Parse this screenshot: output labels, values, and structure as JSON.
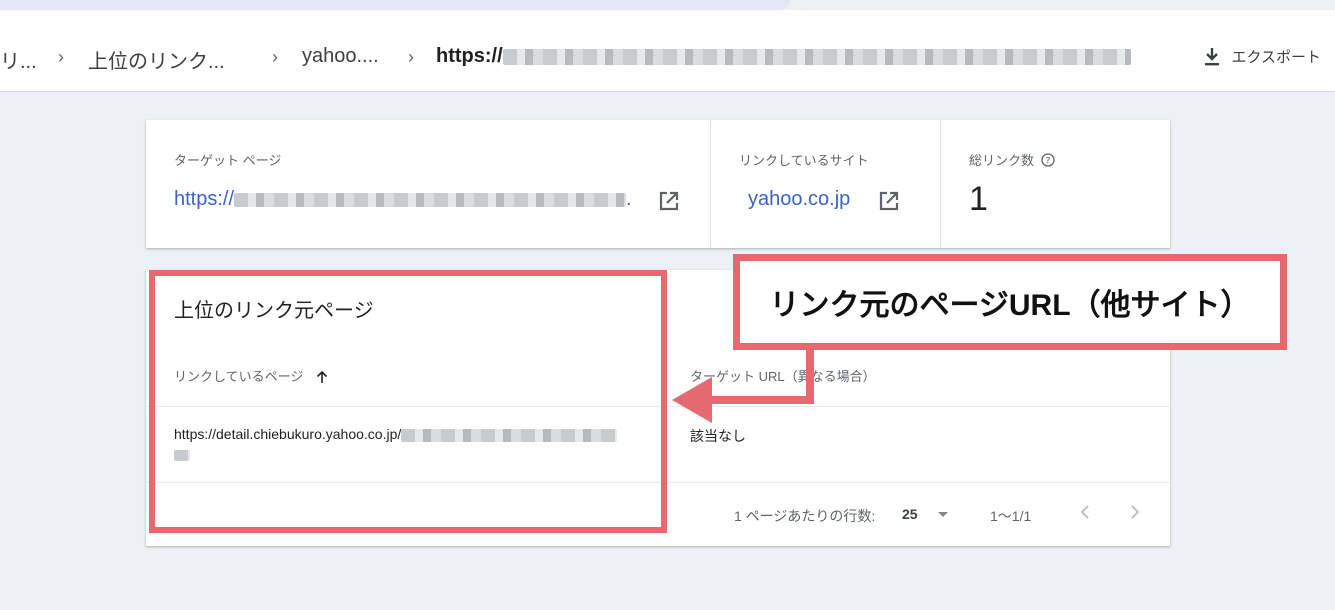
{
  "breadcrumb": {
    "item1": "リ...",
    "item2": "上位のリンク...",
    "item3": "yahoo....",
    "item4": "https://"
  },
  "header": {
    "export_label": "エクスポート",
    "export_icon": "download-icon"
  },
  "summary": {
    "target_label": "ターゲット ページ",
    "target_url_prefix": "https://",
    "target_url_suffix": ".",
    "site_label": "リンクしているサイト",
    "site_value": "yahoo.co.jp",
    "total_label": "総リンク数",
    "total_value": "1",
    "help_icon": "help-icon",
    "external_icon": "open-in-new-icon"
  },
  "table": {
    "title": "上位のリンク元ページ",
    "col1_header": "リンクしているページ",
    "col2_header": "ターゲット URL（異なる場合）",
    "sort_icon": "arrow-up-icon",
    "rows": [
      {
        "linking_page": "https://detail.chiebukuro.yahoo.co.jp/",
        "target_url": "該当なし"
      }
    ],
    "pager": {
      "rows_per_page_label": "1 ページあたりの行数:",
      "rows_per_page_value": "25",
      "range": "1〜1/1"
    }
  },
  "annotation": {
    "callout_text": "リンク元のページURL（他サイト）",
    "color": "#e46a70"
  }
}
